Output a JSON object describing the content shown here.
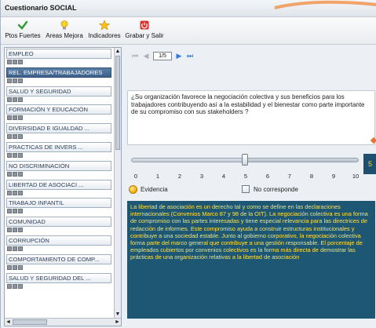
{
  "window": {
    "title": "Cuestionario SOCIAL"
  },
  "toolbar": {
    "buttons": [
      {
        "label": "Ptos Fuertes",
        "icon": "checkmark-icon",
        "color": "#2e9a2e"
      },
      {
        "label": "Areas Mejora",
        "icon": "lightbulb-icon",
        "color": "#f2c21a"
      },
      {
        "label": "Indicadores",
        "icon": "star-icon",
        "color": "#f2b21a"
      },
      {
        "label": "Grabar y Salir",
        "icon": "power-icon",
        "color": "#d6342c"
      }
    ]
  },
  "sidebar": {
    "items": [
      {
        "label": "EMPLEO"
      },
      {
        "label": "REL. EMPRESA/TRABAJADORES"
      },
      {
        "label": "SALUD Y SEGURIDAD"
      },
      {
        "label": "FORMACIÓN Y EDUCACIÓN"
      },
      {
        "label": "DIVERSIDAD E IGUALDAD ..."
      },
      {
        "label": "PRACTICAS DE INVERS ..."
      },
      {
        "label": "NO DISCRIMINACIÓN"
      },
      {
        "label": "LIBERTAD DE ASOCIACI ..."
      },
      {
        "label": "TRABAJO INFANTIL"
      },
      {
        "label": "COMUNIDAD"
      },
      {
        "label": "CORRUPCIÓN"
      },
      {
        "label": "COMPORTAMIENTO DE COMP..."
      },
      {
        "label": "SALUD Y SEGURIDAD DEL ..."
      }
    ],
    "selected_index": 1
  },
  "pager": {
    "page_text": "1/5"
  },
  "question": {
    "text": "¿Su organización favorece la negociación colectiva y sus beneficios para los trabajadores contribuyendo así a la estabilidad y  el bienestar como parte importante de su compromiso con sus stakeholders ?"
  },
  "slider": {
    "min": 0,
    "max": 10,
    "value": 5,
    "ticks": [
      "0",
      "1",
      "2",
      "3",
      "4",
      "5",
      "6",
      "7",
      "8",
      "9",
      "10"
    ],
    "score_text": "5"
  },
  "options": {
    "evidence_label": "Evidencia",
    "no_corresponde_label": "No corresponde"
  },
  "explanation": {
    "text": "La libertad de asociación es un derecho tal y como se define en las declaraciones internacionales (Convenios Marco 87 y 98 de la OIT). La negociación colectiva es una forma de compromiso con las partes interesadas y tiene especial relevancia para las directrices de redacción de informes. Este compromiso ayuda a construir estructuras institucionales y contribuye a una sociedad estable. Junto al gobierno corporativo, la negociación colectiva forma parte del marco general que contribuye a una gestión responsable. El porcentaje de empleados cubiertos por convenios colectivos es la forma más directa de demostrar las prácticas de una organización relativas a la libertad de asociación"
  },
  "colors": {
    "explanation_bg": "#1e5774",
    "explanation_text": "#ffe24d",
    "selected_item_bg": "#4a6f98"
  }
}
